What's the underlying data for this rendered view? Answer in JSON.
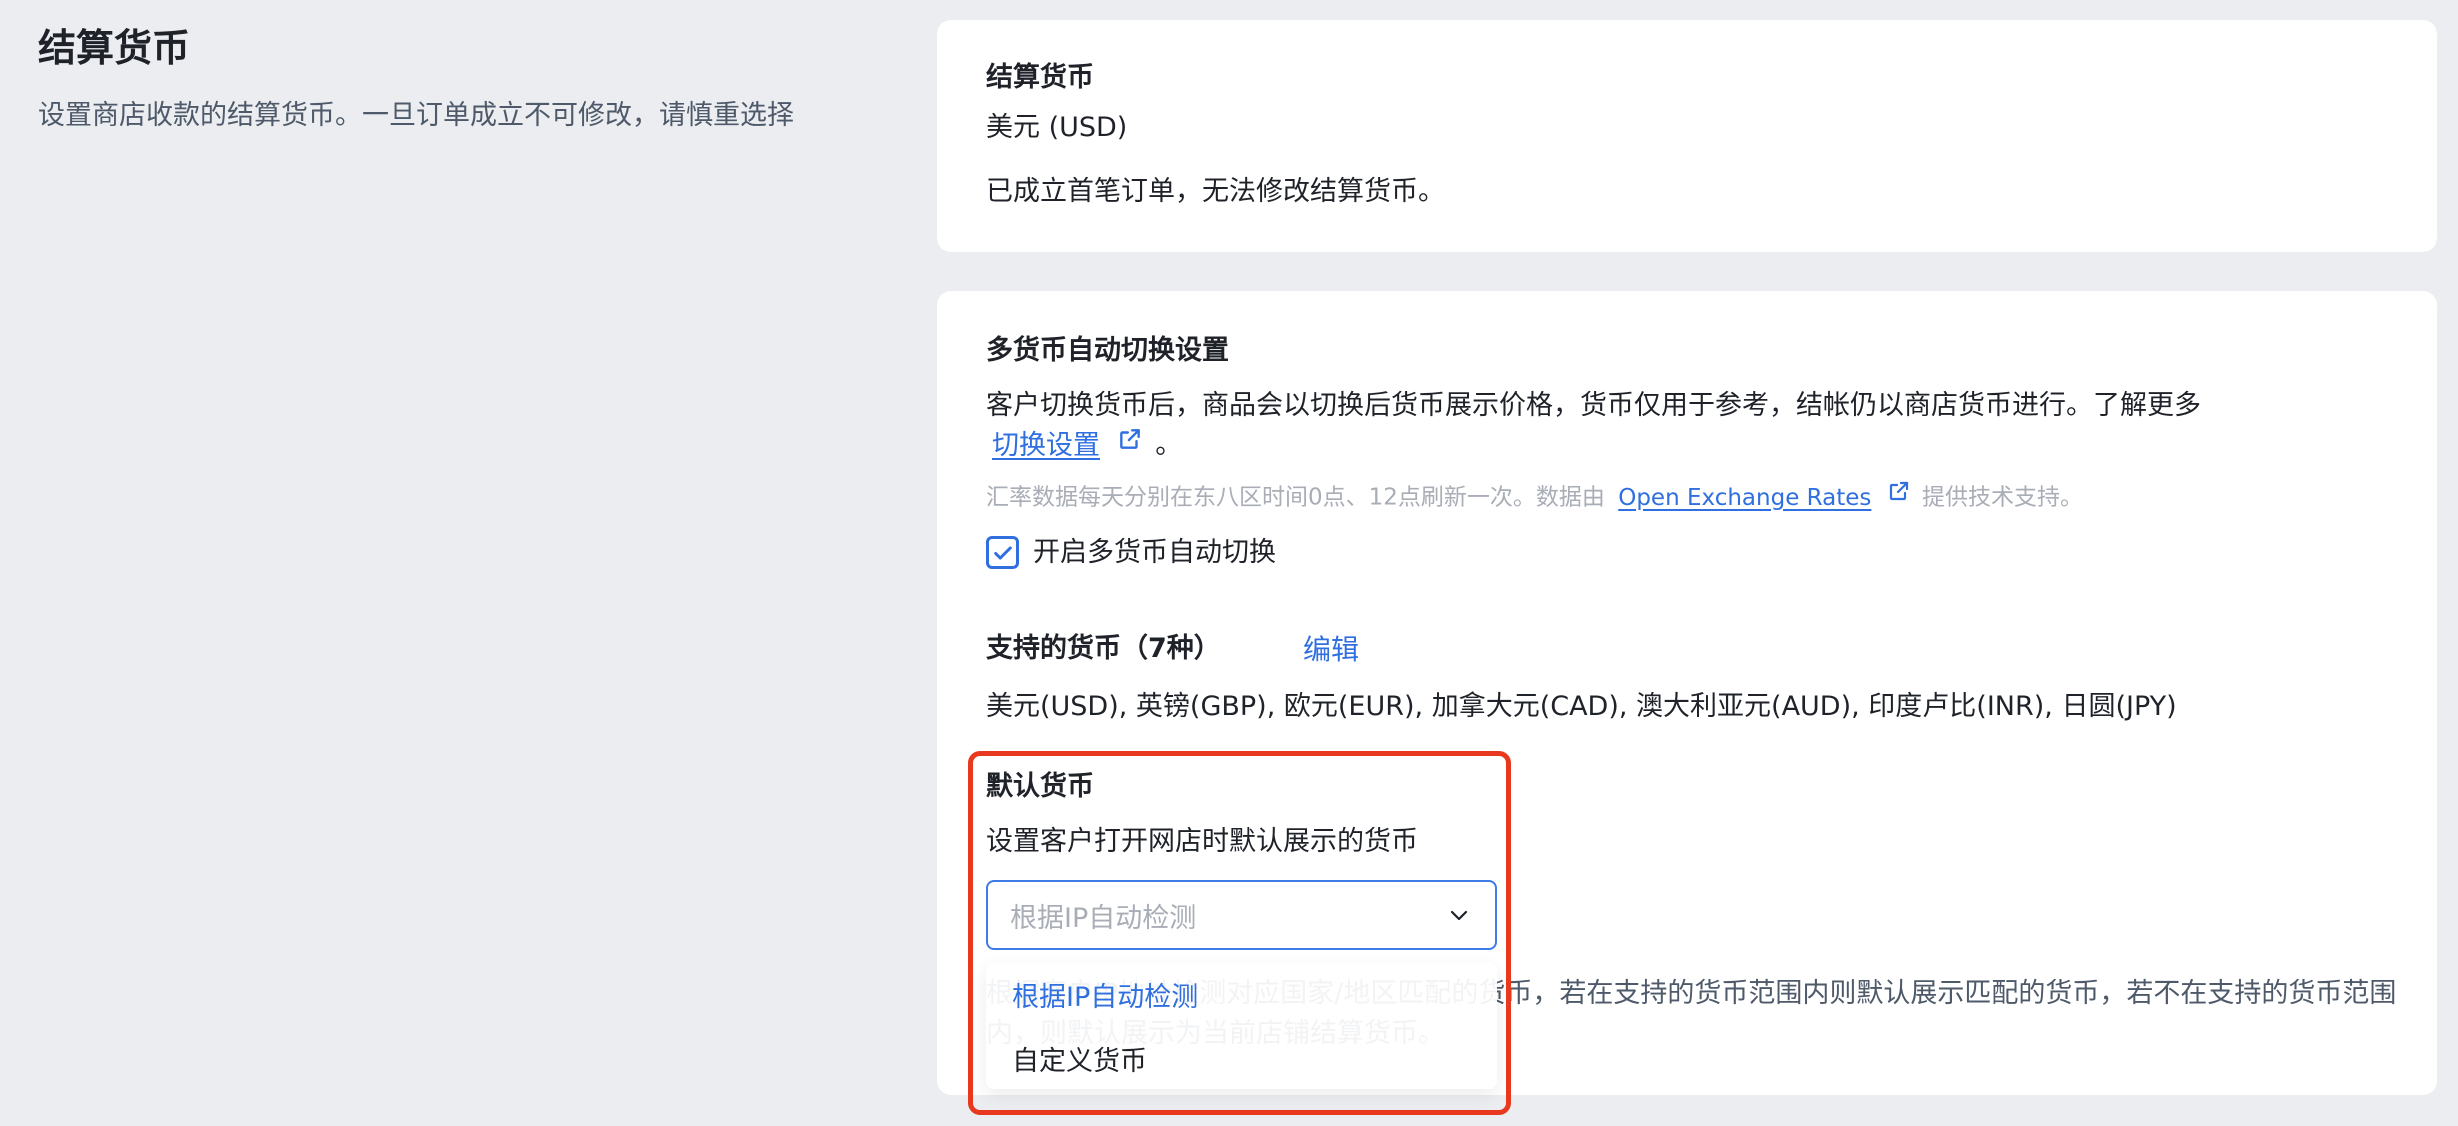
{
  "left": {
    "title": "结算货币",
    "description": "设置商店收款的结算货币。一旦订单成立不可修改，请慎重选择"
  },
  "settlement": {
    "label": "结算货币",
    "value": "美元 (USD)",
    "note": "已成立首笔订单，无法修改结算货币。"
  },
  "multi": {
    "title": "多货币自动切换设置",
    "description": "客户切换货币后，商品会以切换后货币展示价格，货币仅用于参考，结帐仍以商店货币进行。了解更多",
    "learn_more_link": "切换设置",
    "learn_more_suffix": "。",
    "rate_note_prefix": "汇率数据每天分别在东八区时间0点、12点刷新一次。数据由",
    "rate_link": "Open Exchange Rates",
    "rate_note_suffix": "提供技术支持。",
    "checkbox_label": "开启多货币自动切换",
    "checkbox_checked": true,
    "supported_label": "支持的货币（7种）",
    "edit_label": "编辑",
    "supported_list": "美元(USD), 英镑(GBP), 欧元(EUR), 加拿大元(CAD), 澳大利亚元(AUD), 印度卢比(INR), 日圆(JPY)"
  },
  "default_currency": {
    "label": "默认货币",
    "description": "设置客户打开网店时默认展示的货币",
    "selected": "根据IP自动检测",
    "options": [
      "根据IP自动检测",
      "自定义货币"
    ],
    "hint": "根据客户IP地址检测对应国家/地区匹配的货币，若在支持的货币范围内则默认展示匹配的货币，若不在支持的货币范围内，则默认展示为当前店铺结算货币。"
  },
  "colors": {
    "accent": "#2f6fe0",
    "highlight": "#e8391f"
  }
}
